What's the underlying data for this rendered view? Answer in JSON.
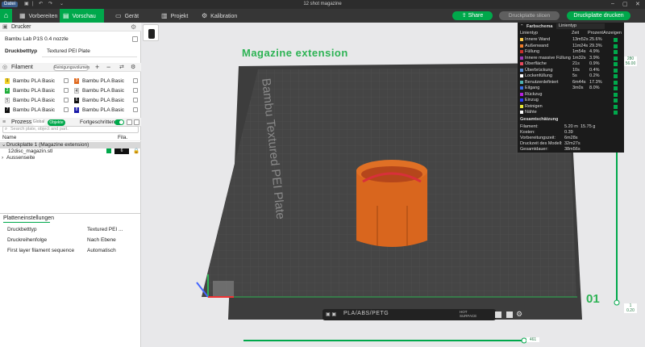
{
  "window": {
    "file_menu": "Datei",
    "title": "12 shot magazine"
  },
  "tabs": [
    {
      "label": "Vorbereiten"
    },
    {
      "label": "Vorschau"
    },
    {
      "label": "Gerät"
    },
    {
      "label": "Projekt"
    },
    {
      "label": "Kalibration"
    }
  ],
  "actions": {
    "share": "Share",
    "slice": "Druckplatte slicen",
    "print": "Druckplatte drucken"
  },
  "printer": {
    "section": "Drucker",
    "name": "Bambu Lab P1S 0.4 nozzle",
    "bed_label": "Druckbetttyp",
    "bed_value": "Textured PEI Plate"
  },
  "filament": {
    "section": "Filament",
    "clean_button": "Reinigungsvolumen",
    "items": [
      {
        "num": "1",
        "name": "Bambu PLA Basic",
        "color": "#f2d024"
      },
      {
        "num": "3",
        "name": "Bambu PLA Basic",
        "color": "#e06a1f"
      },
      {
        "num": "2",
        "name": "Bambu PLA Basic",
        "color": "#1fae3a"
      },
      {
        "num": "4",
        "name": "Bambu PLA Basic",
        "color": "#e9e9e9"
      },
      {
        "num": "5",
        "name": "Bambu PLA Basic",
        "color": "#ffffff"
      },
      {
        "num": "6",
        "name": "Bambu PLA Basic",
        "color": "#111111"
      },
      {
        "num": "7",
        "name": "Bambu PLA Basic",
        "color": "#111111"
      },
      {
        "num": "8",
        "name": "Bambu PLA Basic",
        "color": "#1a1aa8"
      }
    ]
  },
  "process": {
    "section": "Prozess",
    "global": "Global",
    "objects": "Objekte",
    "advanced": "Fortgeschritten",
    "search_placeholder": "Search plate, object and part.",
    "col_name": "Name",
    "col_fila": "Fila.",
    "plate": "Druckplatte 1 (Magazine extension)",
    "object": "12disc_magazin.stl",
    "object_fila": "6",
    "outside": "Aussenseite"
  },
  "plate_settings": {
    "title": "Platteneinstellungen",
    "rows": [
      {
        "label": "Druckbetttyp",
        "value": "Textured PEI ..."
      },
      {
        "label": "Druckreihenfolge",
        "value": "Nach Ebene"
      },
      {
        "label": "First layer filament sequence",
        "value": "Automatisch"
      }
    ]
  },
  "legend": {
    "header": "Farbschema",
    "scheme": "Linientyp",
    "col_type": "Linientyp",
    "col_time": "Zeit",
    "col_pct": "Prozent",
    "col_show": "Anzeigen",
    "rows": [
      {
        "name": "Innere Wand",
        "time": "13m52s",
        "pct": "25.6%",
        "color": "#f7c64a"
      },
      {
        "name": "Außenwand",
        "time": "11m24s",
        "pct": "29.3%",
        "color": "#f07c2a"
      },
      {
        "name": "Füllung",
        "time": "1m54s",
        "pct": "4.9%",
        "color": "#c9302c"
      },
      {
        "name": "Innere massive Füllung",
        "time": "1m32s",
        "pct": "3.9%",
        "color": "#9a39b5"
      },
      {
        "name": "Oberfläche",
        "time": "21s",
        "pct": "0.9%",
        "color": "#e84a5f"
      },
      {
        "name": "Überbrückung",
        "time": "10s",
        "pct": "0.4%",
        "color": "#5b8fd6"
      },
      {
        "name": "Lockenfüllung",
        "time": "5s",
        "pct": "0.2%",
        "color": "#ffffff"
      },
      {
        "name": "Benutzerdefiniert",
        "time": "6m44s",
        "pct": "17.3%",
        "color": "#4eb3b3"
      },
      {
        "name": "Eilgang",
        "time": "3m0s",
        "pct": "8.0%",
        "color": "#3a6ee8"
      },
      {
        "name": "Rückzug",
        "time": "",
        "pct": "",
        "color": "#b620e0"
      },
      {
        "name": "Einzug",
        "time": "",
        "pct": "",
        "color": "#2a3cff"
      },
      {
        "name": "Reinigen",
        "time": "",
        "pct": "",
        "color": "#e8e83a"
      },
      {
        "name": "Nähte",
        "time": "",
        "pct": "",
        "color": "#ffffff"
      }
    ],
    "summary_title": "Gesamtschätzung",
    "summary": [
      {
        "label": "Filament:",
        "v1": "5.20 m",
        "v2": "15.75 g"
      },
      {
        "label": "Kosten:",
        "v1": "0.39",
        "v2": ""
      },
      {
        "label": "Vorbereitungszeit:",
        "v1": "6m28s",
        "v2": ""
      },
      {
        "label": "Druckzeit des Modell:",
        "v1": "32m27s",
        "v2": ""
      },
      {
        "label": "Gesamtdauer:",
        "v1": "38m56s",
        "v2": ""
      }
    ]
  },
  "viewport": {
    "plate_title": "Magazine extension",
    "bed_text": "Bambu Textured PEI Plate",
    "plate_number": "01",
    "material_text": "PLA/ABS/PETG",
    "surface_text": "HOT SURFACE",
    "slider_top_a": "280",
    "slider_top_b": "56.00",
    "slider_bottom_a": "1",
    "slider_bottom_b": "0.20",
    "hslider_value": "461"
  }
}
